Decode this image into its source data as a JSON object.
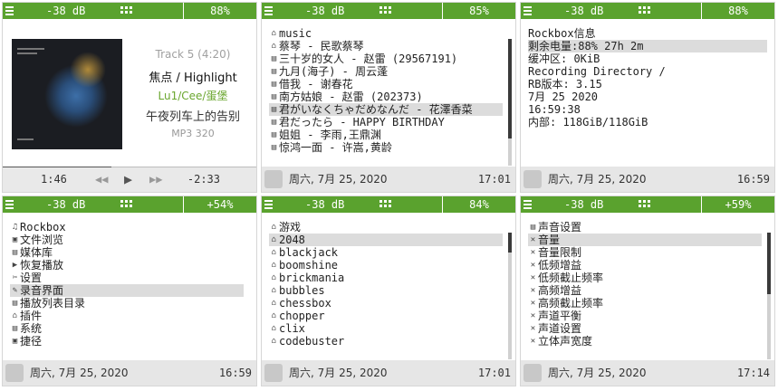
{
  "panels": [
    {
      "statusbar": {
        "volume": "-38 dB",
        "battery": "88%"
      },
      "now_playing": {
        "track": "Track 5 (4:20)",
        "title": "焦点 / Highlight",
        "artist": "Lu1/Cee/蛋堡",
        "album": "午夜列车上的告别",
        "format": "MP3 320",
        "elapsed": "1:46",
        "remaining": "-2:33",
        "progress_fraction": 0.43
      }
    },
    {
      "statusbar": {
        "volume": "-38 dB",
        "battery": "85%"
      },
      "list": [
        {
          "icon": "folder-icon",
          "glyph": "⌂",
          "label": "music"
        },
        {
          "icon": "folder-icon",
          "glyph": "⌂",
          "label": "蔡琴 - 民歌蔡琴"
        },
        {
          "icon": "file-icon",
          "glyph": "▤",
          "label": "三十岁的女人 - 赵雷 (29567191)"
        },
        {
          "icon": "file-icon",
          "glyph": "▤",
          "label": "九月(海子) - 周云蓬"
        },
        {
          "icon": "file-icon",
          "glyph": "▤",
          "label": "借我 - 谢春花"
        },
        {
          "icon": "file-icon",
          "glyph": "▤",
          "label": "南方姑娘 - 赵雷 (202373)"
        },
        {
          "icon": "file-icon",
          "glyph": "▤",
          "label": "君がいなくちゃだめなんだ - 花澤香菜",
          "selected": true
        },
        {
          "icon": "file-icon",
          "glyph": "▤",
          "label": "君だったら - HAPPY BIRTHDAY"
        },
        {
          "icon": "file-icon",
          "glyph": "▤",
          "label": "姐姐 - 李雨,王鼎渊"
        },
        {
          "icon": "file-icon",
          "glyph": "▤",
          "label": "惊鸿一面 - 许嵩,黄龄"
        }
      ],
      "bottombar": {
        "date": "周六, 7月 25, 2020",
        "time": "17:01"
      }
    },
    {
      "statusbar": {
        "volume": "-38 dB",
        "battery": "88%"
      },
      "info": [
        {
          "label": "Rockbox信息"
        },
        {
          "label": "剩余电量:88% 27h 2m",
          "selected": true
        },
        {
          "label": "缓冲区: 0KiB"
        },
        {
          "label": "Recording Directory /"
        },
        {
          "label": "RB版本: 3.15"
        },
        {
          "label": "7月 25 2020"
        },
        {
          "label": "16:59:38"
        },
        {
          "label": "内部: 118GiB/118GiB"
        }
      ],
      "bottombar": {
        "date": "周六, 7月 25, 2020",
        "time": "16:59"
      }
    },
    {
      "statusbar": {
        "volume": "-38 dB",
        "battery": "+54%"
      },
      "list": [
        {
          "icon": "rockbox-icon",
          "glyph": "♫",
          "label": "Rockbox"
        },
        {
          "icon": "file-browser-icon",
          "glyph": "▣",
          "label": "文件浏览"
        },
        {
          "icon": "database-icon",
          "glyph": "▤",
          "label": "媒体库"
        },
        {
          "icon": "resume-playback-icon",
          "glyph": "▶",
          "label": "恢复播放"
        },
        {
          "icon": "settings-icon",
          "glyph": "✂",
          "label": "设置"
        },
        {
          "icon": "recording-icon",
          "glyph": "✎",
          "label": "录音界面",
          "selected": true
        },
        {
          "icon": "playlist-catalog-icon",
          "glyph": "▤",
          "label": "播放列表目录"
        },
        {
          "icon": "plugins-icon",
          "glyph": "⌂",
          "label": "插件"
        },
        {
          "icon": "system-icon",
          "glyph": "▤",
          "label": "系统"
        },
        {
          "icon": "shortcuts-icon",
          "glyph": "▣",
          "label": "捷径"
        }
      ],
      "bottombar": {
        "date": "周六, 7月 25, 2020",
        "time": "16:59"
      }
    },
    {
      "statusbar": {
        "volume": "-38 dB",
        "battery": "84%"
      },
      "list": [
        {
          "icon": "folder-icon",
          "glyph": "⌂",
          "label": "游戏"
        },
        {
          "icon": "plugin-icon",
          "glyph": "⌂",
          "label": "2048",
          "selected": true
        },
        {
          "icon": "plugin-icon",
          "glyph": "⌂",
          "label": "blackjack"
        },
        {
          "icon": "plugin-icon",
          "glyph": "⌂",
          "label": "boomshine"
        },
        {
          "icon": "plugin-icon",
          "glyph": "⌂",
          "label": "brickmania"
        },
        {
          "icon": "plugin-icon",
          "glyph": "⌂",
          "label": "bubbles"
        },
        {
          "icon": "plugin-icon",
          "glyph": "⌂",
          "label": "chessbox"
        },
        {
          "icon": "plugin-icon",
          "glyph": "⌂",
          "label": "chopper"
        },
        {
          "icon": "plugin-icon",
          "glyph": "⌂",
          "label": "clix"
        },
        {
          "icon": "plugin-icon",
          "glyph": "⌂",
          "label": "codebuster"
        }
      ],
      "bottombar": {
        "date": "周六, 7月 25, 2020",
        "time": "17:01"
      }
    },
    {
      "statusbar": {
        "volume": "-38 dB",
        "battery": "+59%"
      },
      "list": [
        {
          "icon": "sound-settings-icon",
          "glyph": "▤",
          "label": "声音设置"
        },
        {
          "icon": "setting-item-icon",
          "glyph": "✕",
          "label": "音量",
          "selected": true
        },
        {
          "icon": "setting-item-icon",
          "glyph": "✕",
          "label": "音量限制"
        },
        {
          "icon": "setting-item-icon",
          "glyph": "✕",
          "label": "低频增益"
        },
        {
          "icon": "setting-item-icon",
          "glyph": "✕",
          "label": "低频截止频率"
        },
        {
          "icon": "setting-item-icon",
          "glyph": "✕",
          "label": "高频增益"
        },
        {
          "icon": "setting-item-icon",
          "glyph": "✕",
          "label": "高频截止频率"
        },
        {
          "icon": "setting-item-icon",
          "glyph": "✕",
          "label": "声道平衡"
        },
        {
          "icon": "setting-item-icon",
          "glyph": "✕",
          "label": "声道设置"
        },
        {
          "icon": "setting-item-icon",
          "glyph": "✕",
          "label": "立体声宽度"
        }
      ],
      "bottombar": {
        "date": "周六, 7月 25, 2020",
        "time": "17:14"
      }
    }
  ],
  "colors": {
    "statusbar": "#5aa22e",
    "artist": "#6aa62e",
    "selection": "#dcdcdc",
    "bottombar": "#e6e6e6"
  }
}
